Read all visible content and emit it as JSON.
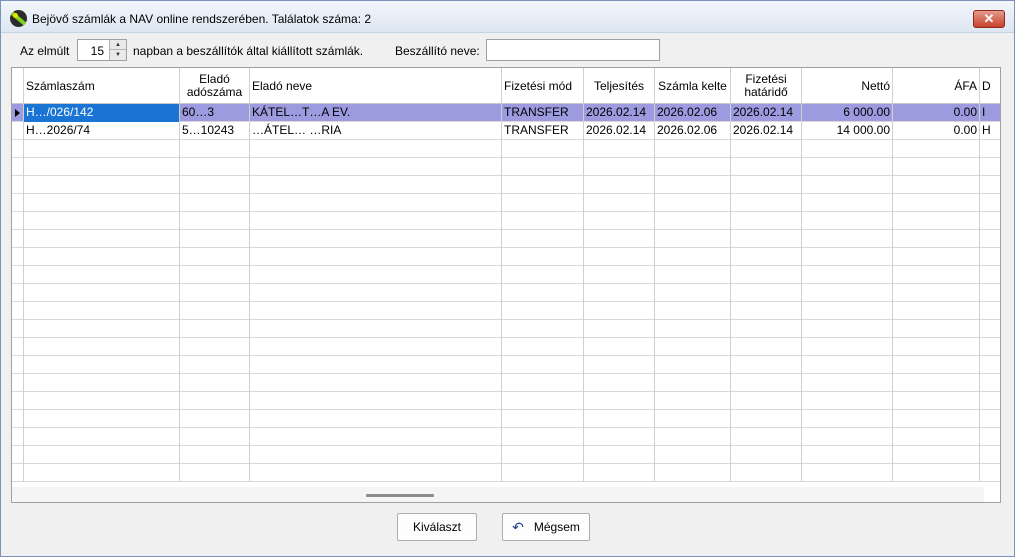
{
  "window": {
    "title": "Bejövő számlák a NAV online rendszerében. Találatok száma: 2",
    "icon": "app-icon",
    "close_label": "✕"
  },
  "filter": {
    "prefix_label": "Az elmúlt",
    "days_value": "15",
    "suffix_label": "napban a beszállítók által kiállított számlák.",
    "supplier_label": "Beszállító neve:",
    "supplier_value": ""
  },
  "grid": {
    "columns": [
      {
        "label": "Számlaszám"
      },
      {
        "label": "Eladó\nadószáma"
      },
      {
        "label": "Eladó neve"
      },
      {
        "label": "Fizetési mód"
      },
      {
        "label": "Teljesítés"
      },
      {
        "label": "Számla kelte"
      },
      {
        "label": "Fizetési\nhatáridő"
      },
      {
        "label": "Nettó"
      },
      {
        "label": "ÁFA"
      },
      {
        "label": "D"
      }
    ],
    "rows": [
      {
        "szamlaszam": "H…/026/142",
        "ado": "60…3",
        "nev": "KÁTEL…T…A EV.",
        "mod": "TRANSFER",
        "teljesites": "2026.02.14",
        "kelte": "2026.02.06",
        "hatarido": "2026.02.14",
        "netto": "6 000.00",
        "afa": "0.00",
        "d": "I"
      },
      {
        "szamlaszam": "H…2026/74",
        "ado": "5…10243",
        "nev": "…ÁTEL… …RIA",
        "mod": "TRANSFER",
        "teljesites": "2026.02.14",
        "kelte": "2026.02.06",
        "hatarido": "2026.02.14",
        "netto": "14 000.00",
        "afa": "0.00",
        "d": "H"
      }
    ]
  },
  "buttons": {
    "select_label": "Kiválaszt",
    "cancel_label": "Mégsem",
    "cancel_icon": "undo-icon"
  },
  "colors": {
    "selected_row": "#9c9be0",
    "selected_cell": "#1a74d4"
  }
}
